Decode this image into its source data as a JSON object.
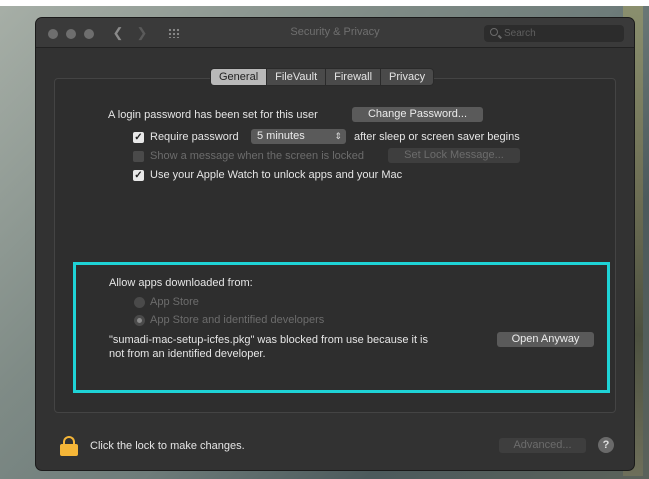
{
  "window": {
    "title": "Security & Privacy",
    "search_placeholder": "Search"
  },
  "tabs": [
    "General",
    "FileVault",
    "Firewall",
    "Privacy"
  ],
  "general": {
    "login_text": "A login password has been set for this user",
    "change_password": "Change Password...",
    "require_password_label": "Require password",
    "require_password_value": "5 minutes",
    "require_password_suffix": "after sleep or screen saver begins",
    "show_message_label": "Show a message when the screen is locked",
    "set_lock_message": "Set Lock Message...",
    "apple_watch_label": "Use your Apple Watch to unlock apps and your Mac"
  },
  "allow_apps": {
    "heading": "Allow apps downloaded from:",
    "options": [
      "App Store",
      "App Store and identified developers"
    ],
    "blocked_line1": "\"sumadi-mac-setup-icfes.pkg\" was blocked from use because it is",
    "blocked_line2": "not from an identified developer.",
    "open_anyway": "Open Anyway"
  },
  "footer": {
    "lock_text": "Click the lock to make changes.",
    "advanced": "Advanced...",
    "help": "?"
  },
  "colors": {
    "highlight": "#1ed3d6",
    "lock": "#f5b638"
  },
  "icons": [
    "back-chevron-icon",
    "forward-chevron-icon",
    "grid-icon",
    "search-icon",
    "checkmark-icon",
    "lock-icon",
    "help-icon"
  ]
}
